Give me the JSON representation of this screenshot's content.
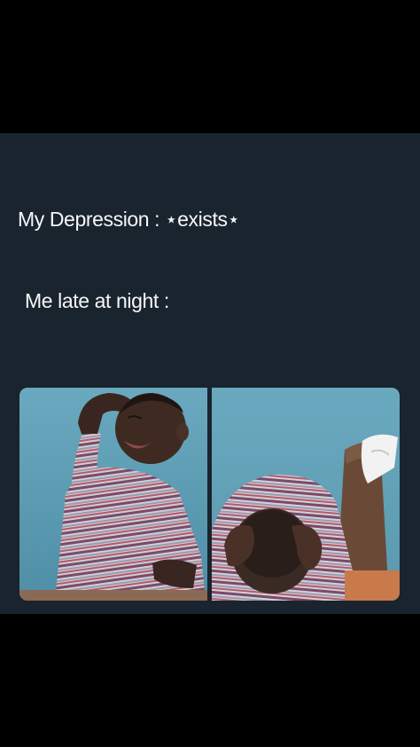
{
  "meme": {
    "line_1": "My Depression : ⋆exists⋆",
    "line_2": "Me late at night :",
    "images": [
      {
        "icon": "crying-boy-holding-head-image"
      },
      {
        "icon": "boy-clutching-head-bent-over-image"
      }
    ]
  },
  "colors": {
    "page_background": "#000000",
    "card_background": "#1a242e",
    "text": "#f5f7f9",
    "photo_wall": "#5f9fb6"
  }
}
